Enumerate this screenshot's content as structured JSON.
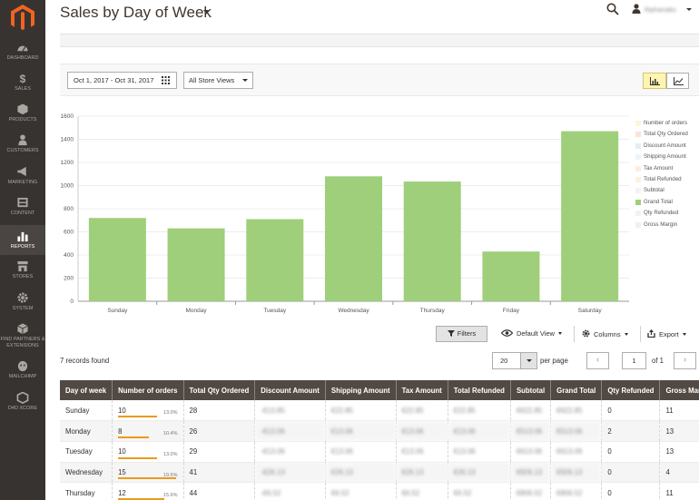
{
  "sidebar": {
    "items": [
      {
        "label": "DASHBOARD",
        "icon": "dashboard-icon"
      },
      {
        "label": "SALES",
        "icon": "dollar-icon"
      },
      {
        "label": "PRODUCTS",
        "icon": "box-icon"
      },
      {
        "label": "CUSTOMERS",
        "icon": "person-icon"
      },
      {
        "label": "MARKETING",
        "icon": "megaphone-icon"
      },
      {
        "label": "CONTENT",
        "icon": "content-icon"
      },
      {
        "label": "REPORTS",
        "icon": "bar-chart-icon",
        "active": true
      },
      {
        "label": "STORES",
        "icon": "store-icon"
      },
      {
        "label": "SYSTEM",
        "icon": "gear-icon"
      },
      {
        "label": "FIND PARTNERS & EXTENSIONS",
        "icon": "cube-icon"
      },
      {
        "label": "MAILCHIMP",
        "icon": "mailchimp-icon"
      },
      {
        "label": "D4D XCORE",
        "icon": "hexagon-icon"
      }
    ]
  },
  "header": {
    "title": "Sales by Day of Week",
    "user_name": "thphanaks"
  },
  "filters": {
    "date_range": "Oct 1, 2017 - Oct 31, 2017",
    "store_view": "All Store Views"
  },
  "chart_data": {
    "type": "bar",
    "categories": [
      "Sunday",
      "Monday",
      "Tuesday",
      "Wednesday",
      "Thursday",
      "Friday",
      "Saturday"
    ],
    "series": [
      {
        "name": "Grand Total",
        "values": [
          720,
          630,
          710,
          1080,
          1035,
          430,
          1470
        ]
      }
    ],
    "yticks": [
      0,
      200,
      400,
      600,
      800,
      1000,
      1200,
      1400,
      1600
    ],
    "ylim": [
      0,
      1600
    ],
    "bar_color": "#9fcf7a",
    "legend": [
      {
        "label": "Number of orders",
        "color": "#fdf6d9"
      },
      {
        "label": "Total Qty Ordered",
        "color": "#fbe3dc"
      },
      {
        "label": "Discount Amount",
        "color": "#e4edf7"
      },
      {
        "label": "Shipping Amount",
        "color": "#eef3f7"
      },
      {
        "label": "Tax Amount",
        "color": "#fbeee2"
      },
      {
        "label": "Total Refunded",
        "color": "#fbf4dc"
      },
      {
        "label": "Subtotal",
        "color": "#f3f3f3"
      },
      {
        "label": "Grand Total",
        "color": "#9fcf7a"
      },
      {
        "label": "Qty Refunded",
        "color": "#eef3f7"
      },
      {
        "label": "Gross Margin",
        "color": "#f0f0f0"
      }
    ],
    "legend_position": "right"
  },
  "toolbar": {
    "filters_label": "Filters",
    "view_label": "Default View",
    "columns_label": "Columns",
    "export_label": "Export"
  },
  "grid": {
    "records_found": "7 records found",
    "per_page": "20",
    "per_page_label": "per page",
    "page": "1",
    "of_pages": "of 1",
    "columns": [
      "Day of week",
      "Number of orders",
      "Total Qty Ordered",
      "Discount Amount",
      "Shipping Amount",
      "Tax Amount",
      "Total Refunded",
      "Subtotal",
      "Grand Total",
      "Qty Refunded",
      "Gross Margin"
    ],
    "rows": [
      {
        "day": "Sunday",
        "orders": "10",
        "pct": "13.0%",
        "pct_value": 13.0,
        "qty": "28",
        "discount": "-€13.85",
        "shipping": "€22.85",
        "tax": "€22.85",
        "refunded": "€22.85",
        "subtotal": "€622.85",
        "grand_total": "€622.85",
        "qty_refunded": "0",
        "gross_margin": "11"
      },
      {
        "day": "Monday",
        "orders": "8",
        "pct": "10.4%",
        "pct_value": 10.4,
        "qty": "26",
        "discount": "-€13.06",
        "shipping": "€13.06",
        "tax": "€13.06",
        "refunded": "€13.06",
        "subtotal": "€513.06",
        "grand_total": "€513.06",
        "qty_refunded": "2",
        "gross_margin": "13"
      },
      {
        "day": "Tuesday",
        "orders": "10",
        "pct": "13.0%",
        "pct_value": 13.0,
        "qty": "29",
        "discount": "-€13.06",
        "shipping": "€13.06",
        "tax": "€13.06",
        "refunded": "€13.06",
        "subtotal": "€613.06",
        "grand_total": "€613.06",
        "qty_refunded": "0",
        "gross_margin": "13"
      },
      {
        "day": "Wednesday",
        "orders": "15",
        "pct": "19.5%",
        "pct_value": 19.5,
        "qty": "41",
        "discount": "-€26.13",
        "shipping": "€26.13",
        "tax": "€26.13",
        "refunded": "€26.13",
        "subtotal": "€926.13",
        "grand_total": "€926.13",
        "qty_refunded": "0",
        "gross_margin": "4"
      },
      {
        "day": "Thursday",
        "orders": "12",
        "pct": "15.6%",
        "pct_value": 15.6,
        "qty": "44",
        "discount": "-€6.52",
        "shipping": "€6.52",
        "tax": "€6.52",
        "refunded": "€6.52",
        "subtotal": "€806.52",
        "grand_total": "€806.52",
        "qty_refunded": "0",
        "gross_margin": "11"
      }
    ]
  }
}
